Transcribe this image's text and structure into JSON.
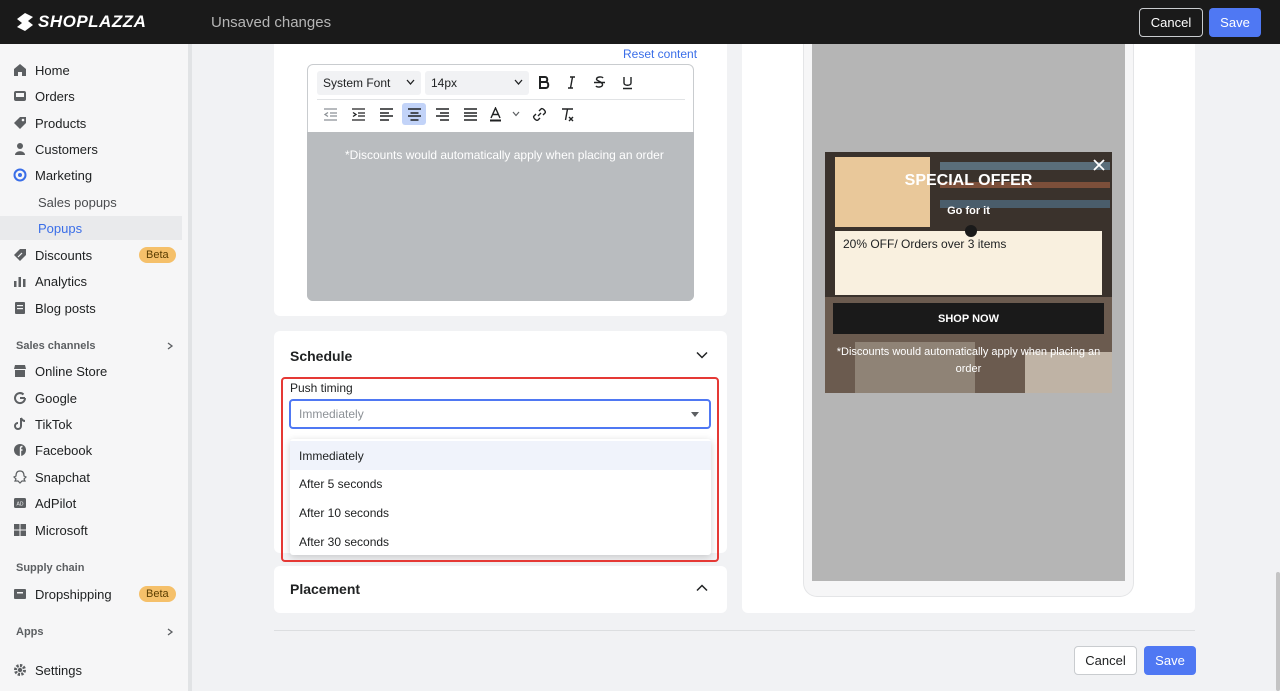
{
  "topbar": {
    "brand": "SHOPLAZZA",
    "status": "Unsaved changes",
    "cancel_label": "Cancel",
    "save_label": "Save"
  },
  "sidebar": {
    "items": [
      {
        "label": "Home",
        "icon": "home-icon"
      },
      {
        "label": "Orders",
        "icon": "inbox-icon"
      },
      {
        "label": "Products",
        "icon": "tag-icon"
      },
      {
        "label": "Customers",
        "icon": "person-icon"
      },
      {
        "label": "Marketing",
        "icon": "target-icon"
      },
      {
        "label": "Sales popups"
      },
      {
        "label": "Popups"
      },
      {
        "label": "Discounts",
        "icon": "discount-icon",
        "badge": "Beta"
      },
      {
        "label": "Analytics",
        "icon": "bar-chart-icon"
      },
      {
        "label": "Blog posts",
        "icon": "document-icon"
      }
    ],
    "sales_channels_title": "Sales channels",
    "channels": [
      {
        "label": "Online Store",
        "icon": "store-icon"
      },
      {
        "label": "Google",
        "icon": "google-icon"
      },
      {
        "label": "TikTok",
        "icon": "tiktok-icon"
      },
      {
        "label": "Facebook",
        "icon": "facebook-icon"
      },
      {
        "label": "Snapchat",
        "icon": "snapchat-icon"
      },
      {
        "label": "AdPilot",
        "icon": "adpilot-icon"
      },
      {
        "label": "Microsoft",
        "icon": "microsoft-icon"
      }
    ],
    "supply_chain_title": "Supply chain",
    "dropshipping": {
      "label": "Dropshipping",
      "badge": "Beta"
    },
    "apps_title": "Apps",
    "settings_label": "Settings"
  },
  "editor": {
    "reset_label": "Reset content",
    "font_value": "System Font",
    "size_value": "14px",
    "content": "*Discounts would automatically apply when placing an order"
  },
  "schedule": {
    "title": "Schedule",
    "push_label": "Push timing",
    "push_value": "Immediately",
    "options": [
      "Immediately",
      "After 5 seconds",
      "After 10 seconds",
      "After 30 seconds"
    ],
    "selected_index": 0
  },
  "placement": {
    "title": "Placement"
  },
  "preview": {
    "title": "SPECIAL OFFER",
    "subtitle": "Go for it",
    "coupon": "20% OFF/ Orders over 3 items",
    "cta": "SHOP NOW",
    "disclaimer": "*Discounts would automatically apply when placing an order"
  },
  "footer": {
    "cancel_label": "Cancel",
    "save_label": "Save"
  },
  "colors": {
    "accent": "#4f78f3",
    "highlight": "#e53935",
    "badge": "#f5c06a"
  }
}
